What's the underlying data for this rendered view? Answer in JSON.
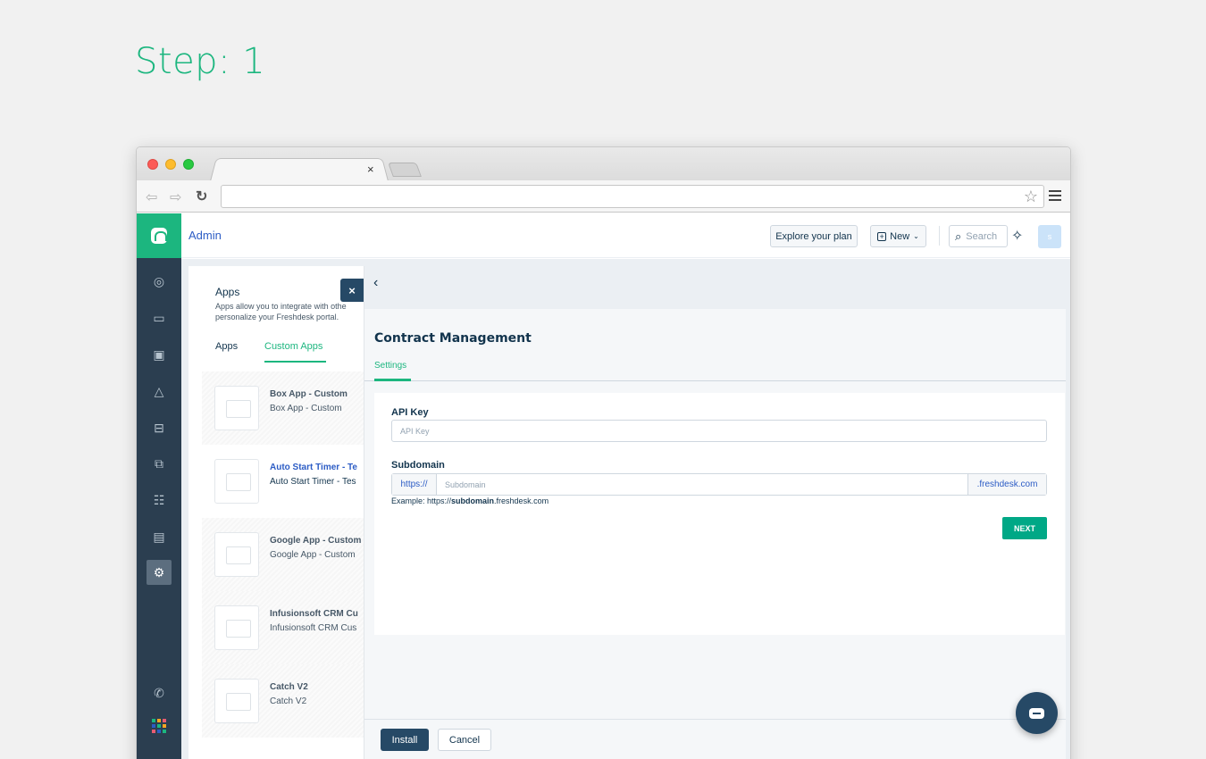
{
  "step": {
    "title": "Step: 1"
  },
  "browser": {
    "tab_close": "×",
    "star": "☆"
  },
  "header": {
    "title": "Admin",
    "explore_label": "Explore your plan",
    "new_label": "New",
    "search_placeholder": "Search",
    "avatar_initial": "s"
  },
  "sidebar": {
    "items": [
      {
        "icon": "dashboard-icon",
        "glyph": "◎"
      },
      {
        "icon": "ticket-icon",
        "glyph": "▭"
      },
      {
        "icon": "contacts-icon",
        "glyph": "▣"
      },
      {
        "icon": "network-icon",
        "glyph": "△"
      },
      {
        "icon": "solutions-book-icon",
        "glyph": "⊟"
      },
      {
        "icon": "forums-icon",
        "glyph": "⧉"
      },
      {
        "icon": "tasks-icon",
        "glyph": "☷"
      },
      {
        "icon": "reports-icon",
        "glyph": "▤"
      },
      {
        "icon": "admin-gear-icon",
        "glyph": "⚙"
      },
      {
        "icon": "phone-icon",
        "glyph": "✆"
      },
      {
        "icon": "apps-grid-icon",
        "glyph": ""
      }
    ]
  },
  "apps_panel": {
    "title": "Apps",
    "description": "Apps allow you to integrate with othe\npersonalize your Freshdesk portal.",
    "tabs": [
      "Apps",
      "Custom Apps"
    ],
    "rows": [
      {
        "name": "Box App - Custom",
        "sub": "Box App - Custom"
      },
      {
        "name": "Auto Start Timer - Te",
        "sub": "Auto Start Timer - Tes"
      },
      {
        "name": "Google App - Custom",
        "sub": "Google App - Custom"
      },
      {
        "name": "Infusionsoft CRM Cu",
        "sub": "Infusionsoft CRM Cus"
      },
      {
        "name": "Catch V2",
        "sub": "Catch V2"
      }
    ]
  },
  "drawer": {
    "close": "×",
    "back": "‹",
    "heading": "Contract Management",
    "tab": "Settings",
    "api_key_label": "API Key",
    "api_key_placeholder": "API Key",
    "subdomain_label": "Subdomain",
    "subdomain_prefix": "https://",
    "subdomain_placeholder": "Subdomain",
    "subdomain_suffix": ".freshdesk.com",
    "example_prefix": "Example: https://",
    "example_bold": "subdomain",
    "example_suffix": ".freshdesk.com",
    "next_label": "NEXT",
    "install_label": "Install",
    "cancel_label": "Cancel"
  },
  "colors": {
    "brand_green": "#1cb67f",
    "sidebar_bg": "#2b3e50",
    "primary_dark": "#264966",
    "link_blue": "#2c5cc5"
  }
}
